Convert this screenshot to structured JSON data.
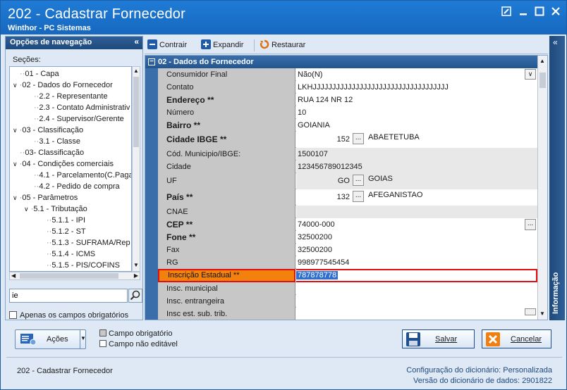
{
  "window": {
    "title": "202 - Cadastrar  Fornecedor",
    "subtitle": "Winthor - PC Sistemas"
  },
  "nav": {
    "header": "Opções de navegação",
    "sections_label": "Seções:",
    "tree": [
      {
        "label": "01 - Capa",
        "level": 1
      },
      {
        "label": "02 - Dados do Fornecedor",
        "level": 1
      },
      {
        "label": "2.2 - Representante",
        "level": 2
      },
      {
        "label": "2.3 - Contato Administrativ",
        "level": 2
      },
      {
        "label": "2.4 - Supervisor/Gerente",
        "level": 2
      },
      {
        "label": "03 - Classificação",
        "level": 1
      },
      {
        "label": "3.1 - Classe",
        "level": 2
      },
      {
        "label": "03- Classificação",
        "level": 1
      },
      {
        "label": "04 - Condições comerciais",
        "level": 1
      },
      {
        "label": "4.1 - Parcelamento(C.Paga",
        "level": 2
      },
      {
        "label": "4.2 - Pedido de compra",
        "level": 2
      },
      {
        "label": "05 - Parâmetros",
        "level": 1
      },
      {
        "label": "5.1 - Tributação",
        "level": 2
      },
      {
        "label": "5.1.1 - IPI",
        "level": 3
      },
      {
        "label": "5.1.2 - ST",
        "level": 3
      },
      {
        "label": "5.1.3 - SUFRAMA/Rep",
        "level": 3
      },
      {
        "label": "5.1.4 - ICMS",
        "level": 3
      },
      {
        "label": "5.1.5 - PIS/COFINS",
        "level": 3
      }
    ],
    "search_value": "ie",
    "only_required_label": "Apenas os campos obrigatórios"
  },
  "toolbar": {
    "contrair": "Contrair",
    "expandir": "Expandir",
    "restaurar": "Restaurar"
  },
  "grid": {
    "section_title": "02 - Dados do Fornecedor",
    "rows": [
      {
        "label": "Consumidor Final",
        "value": "Não(N)"
      },
      {
        "label": "Contato",
        "value": "LKHJJJJJJJJJJJJJJJJJJJJJJJJJJJJJJJJJJJ"
      },
      {
        "label": "Endereço **",
        "value": "RUA 124 NR 12"
      },
      {
        "label": "Número",
        "value": "10"
      },
      {
        "label": "Bairro **",
        "value": "GOIANIA"
      },
      {
        "label": "Cidade IBGE **",
        "code": "152",
        "value": "ABAETETUBA"
      },
      {
        "label": "Cód. Municipio/IBGE:",
        "value": "1500107"
      },
      {
        "label": "Cidade",
        "value": "123456789012345"
      },
      {
        "label": "UF",
        "code": "GO",
        "value": "GOIAS"
      },
      {
        "label": "País **",
        "code": "132",
        "value": "AFEGANISTAO"
      },
      {
        "label": "CNAE",
        "value": ""
      },
      {
        "label": "CEP **",
        "value": "74000-000"
      },
      {
        "label": "Fone **",
        "value": "32500200"
      },
      {
        "label": "Fax",
        "value": "32500200"
      },
      {
        "label": "RG",
        "value": "998977545454"
      },
      {
        "label": "Inscrição Estadual **",
        "value": "787878778"
      },
      {
        "label": "Insc. municipal",
        "value": ""
      },
      {
        "label": "Insc. entrangeira",
        "value": ""
      },
      {
        "label": "Insc est. sub. trib.",
        "value": ""
      }
    ]
  },
  "info_label": "Informação",
  "actions": {
    "acoes": "Ações",
    "legend_required": "Campo obrigatório",
    "legend_not_editable": "Campo não editável",
    "salvar": "Salvar",
    "cancelar": "Cancelar"
  },
  "status": {
    "left": "202 - Cadastrar  Fornecedor",
    "config_label": "Configuração do dicionário:",
    "config_value": "Personalizada",
    "version_label": "Versão do dicionário de dados:",
    "version_value": "2901822"
  },
  "colors": {
    "titlebar": "#1768be",
    "highlight_field": "#f2820d",
    "selection_border": "#e01010"
  }
}
